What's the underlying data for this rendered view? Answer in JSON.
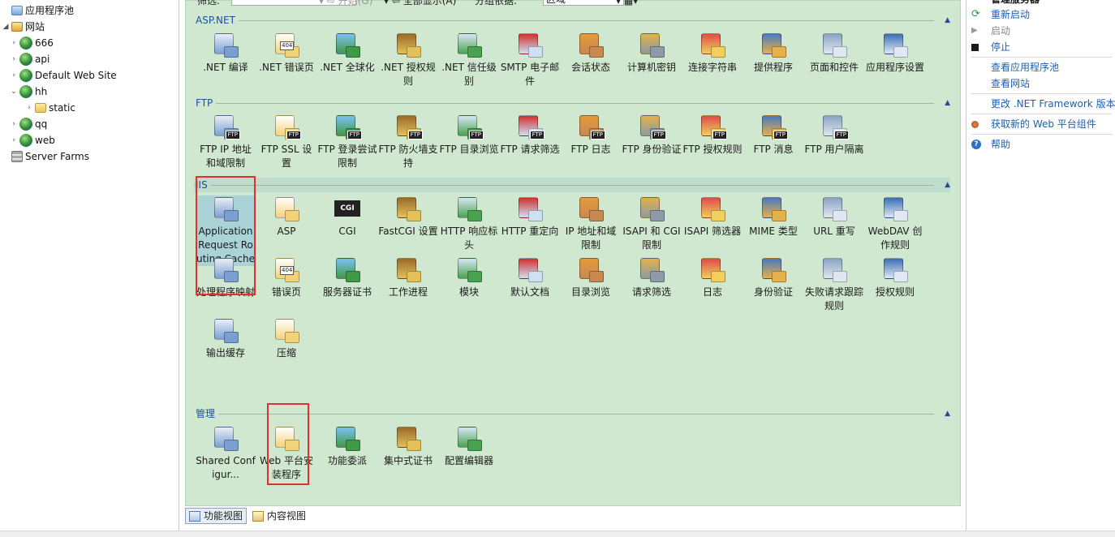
{
  "tree": {
    "items": [
      {
        "label": "应用程序池",
        "icon": "app-pool-icon"
      },
      {
        "label": "网站",
        "icon": "sites-icon"
      },
      {
        "label": "666",
        "icon": "globe-icon"
      },
      {
        "label": "api",
        "icon": "globe-icon"
      },
      {
        "label": "Default Web Site",
        "icon": "globe-icon"
      },
      {
        "label": "hh",
        "icon": "globe-icon"
      },
      {
        "label": "static",
        "icon": "folder-icon"
      },
      {
        "label": "qq",
        "icon": "globe-icon"
      },
      {
        "label": "web",
        "icon": "globe-icon"
      },
      {
        "label": "Server Farms",
        "icon": "server-farm-icon"
      }
    ]
  },
  "toolbar": {
    "filter_label": "筛选:",
    "go_label": "开始(G)",
    "show_all_label": "全部显示(A)",
    "group_by_label": "分组依据:",
    "group_by_value": "区域"
  },
  "sections": {
    "aspnet": {
      "title": "ASP.NET",
      "items": [
        ".NET 编译",
        ".NET 错误页",
        ".NET 全球化",
        ".NET 授权规则",
        ".NET 信任级别",
        "SMTP 电子邮件",
        "会话状态",
        "计算机密钥",
        "连接字符串",
        "提供程序",
        "页面和控件",
        "应用程序设置"
      ]
    },
    "ftp": {
      "title": "FTP",
      "items": [
        "FTP IP 地址和域限制",
        "FTP SSL 设置",
        "FTP 登录尝试限制",
        "FTP 防火墙支持",
        "FTP 目录浏览",
        "FTP 请求筛选",
        "FTP 日志",
        "FTP 身份验证",
        "FTP 授权规则",
        "FTP 消息",
        "FTP 用户隔离"
      ]
    },
    "iis": {
      "title": "IIS",
      "items": [
        "Application Request Routing Cache",
        "ASP",
        "CGI",
        "FastCGI 设置",
        "HTTP 响应标头",
        "HTTP 重定向",
        "IP 地址和域限制",
        "ISAPI 和 CGI 限制",
        "ISAPI 筛选器",
        "MIME 类型",
        "URL 重写",
        "WebDAV 创作规则",
        "处理程序映射",
        "错误页",
        "服务器证书",
        "工作进程",
        "模块",
        "默认文档",
        "目录浏览",
        "请求筛选",
        "日志",
        "身份验证",
        "失败请求跟踪规则",
        "授权规则",
        "输出缓存",
        "压缩"
      ]
    },
    "manage": {
      "title": "管理",
      "items": [
        "Shared Configur...",
        "Web 平台安装程序",
        "功能委派",
        "集中式证书",
        "配置编辑器"
      ]
    }
  },
  "view_tabs": {
    "features": "功能视图",
    "content": "内容视图"
  },
  "actions": {
    "header": "管理服务器",
    "restart": "重新启动",
    "start": "启动",
    "stop": "停止",
    "view_pools": "查看应用程序池",
    "view_sites": "查看网站",
    "change_framework": "更改 .NET Framework 版本",
    "get_components": "获取新的 Web 平台组件",
    "help": "帮助"
  },
  "colors": {
    "pane_bg": "#cfe8cf",
    "link": "#1f5fae",
    "highlight": "#e03030",
    "selected": "#a9d3d6"
  }
}
